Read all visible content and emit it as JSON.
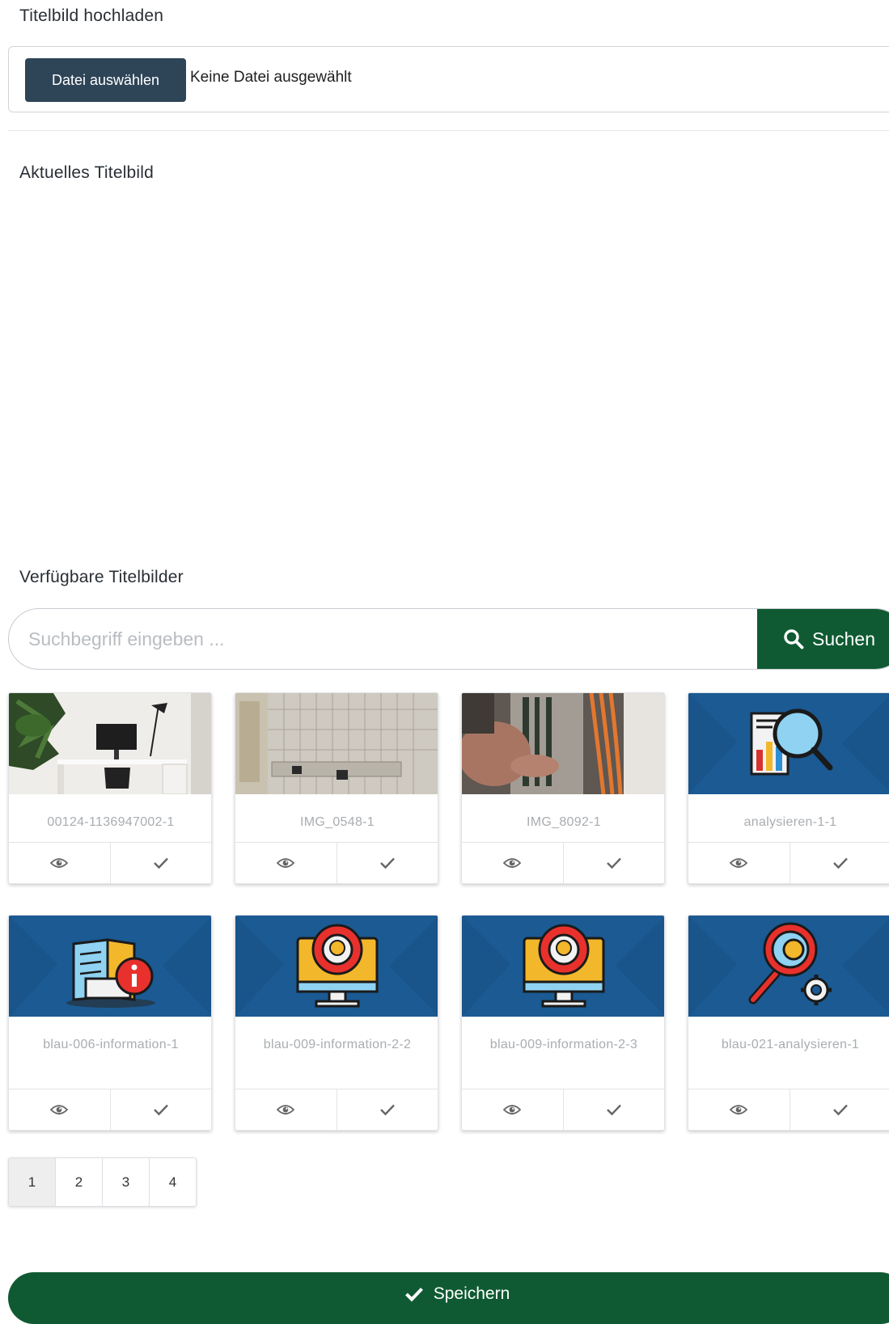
{
  "upload": {
    "title": "Titelbild hochladen",
    "button_label": "Datei auswählen",
    "status": "Keine Datei ausgewählt"
  },
  "current": {
    "title": "Aktuelles Titelbild"
  },
  "available": {
    "title": "Verfügbare Titelbilder",
    "search_placeholder": "Suchbegriff eingeben ...",
    "search_button": "Suchen",
    "images": [
      {
        "name": "00124-1136947002-1",
        "thumb": "photo-desk"
      },
      {
        "name": "IMG_0548-1",
        "thumb": "photo-panel"
      },
      {
        "name": "IMG_8092-1",
        "thumb": "photo-cables"
      },
      {
        "name": "analysieren-1-1",
        "thumb": "chart-magnifier-icon"
      },
      {
        "name": "blau-006-information-1",
        "thumb": "book-info-icon"
      },
      {
        "name": "blau-009-information-2-2",
        "thumb": "monitor-bulb-icon"
      },
      {
        "name": "blau-009-information-2-3",
        "thumb": "monitor-bulb-icon"
      },
      {
        "name": "blau-021-analysieren-1",
        "thumb": "magnifier-gear-icon"
      }
    ],
    "pagination": [
      "1",
      "2",
      "3",
      "4"
    ],
    "current_page": "1"
  },
  "save": {
    "label": "Speichern"
  },
  "colors": {
    "primary_green": "#0f5a32",
    "dark_button": "#2e4457",
    "thumb_blue": "#1b5a93"
  }
}
